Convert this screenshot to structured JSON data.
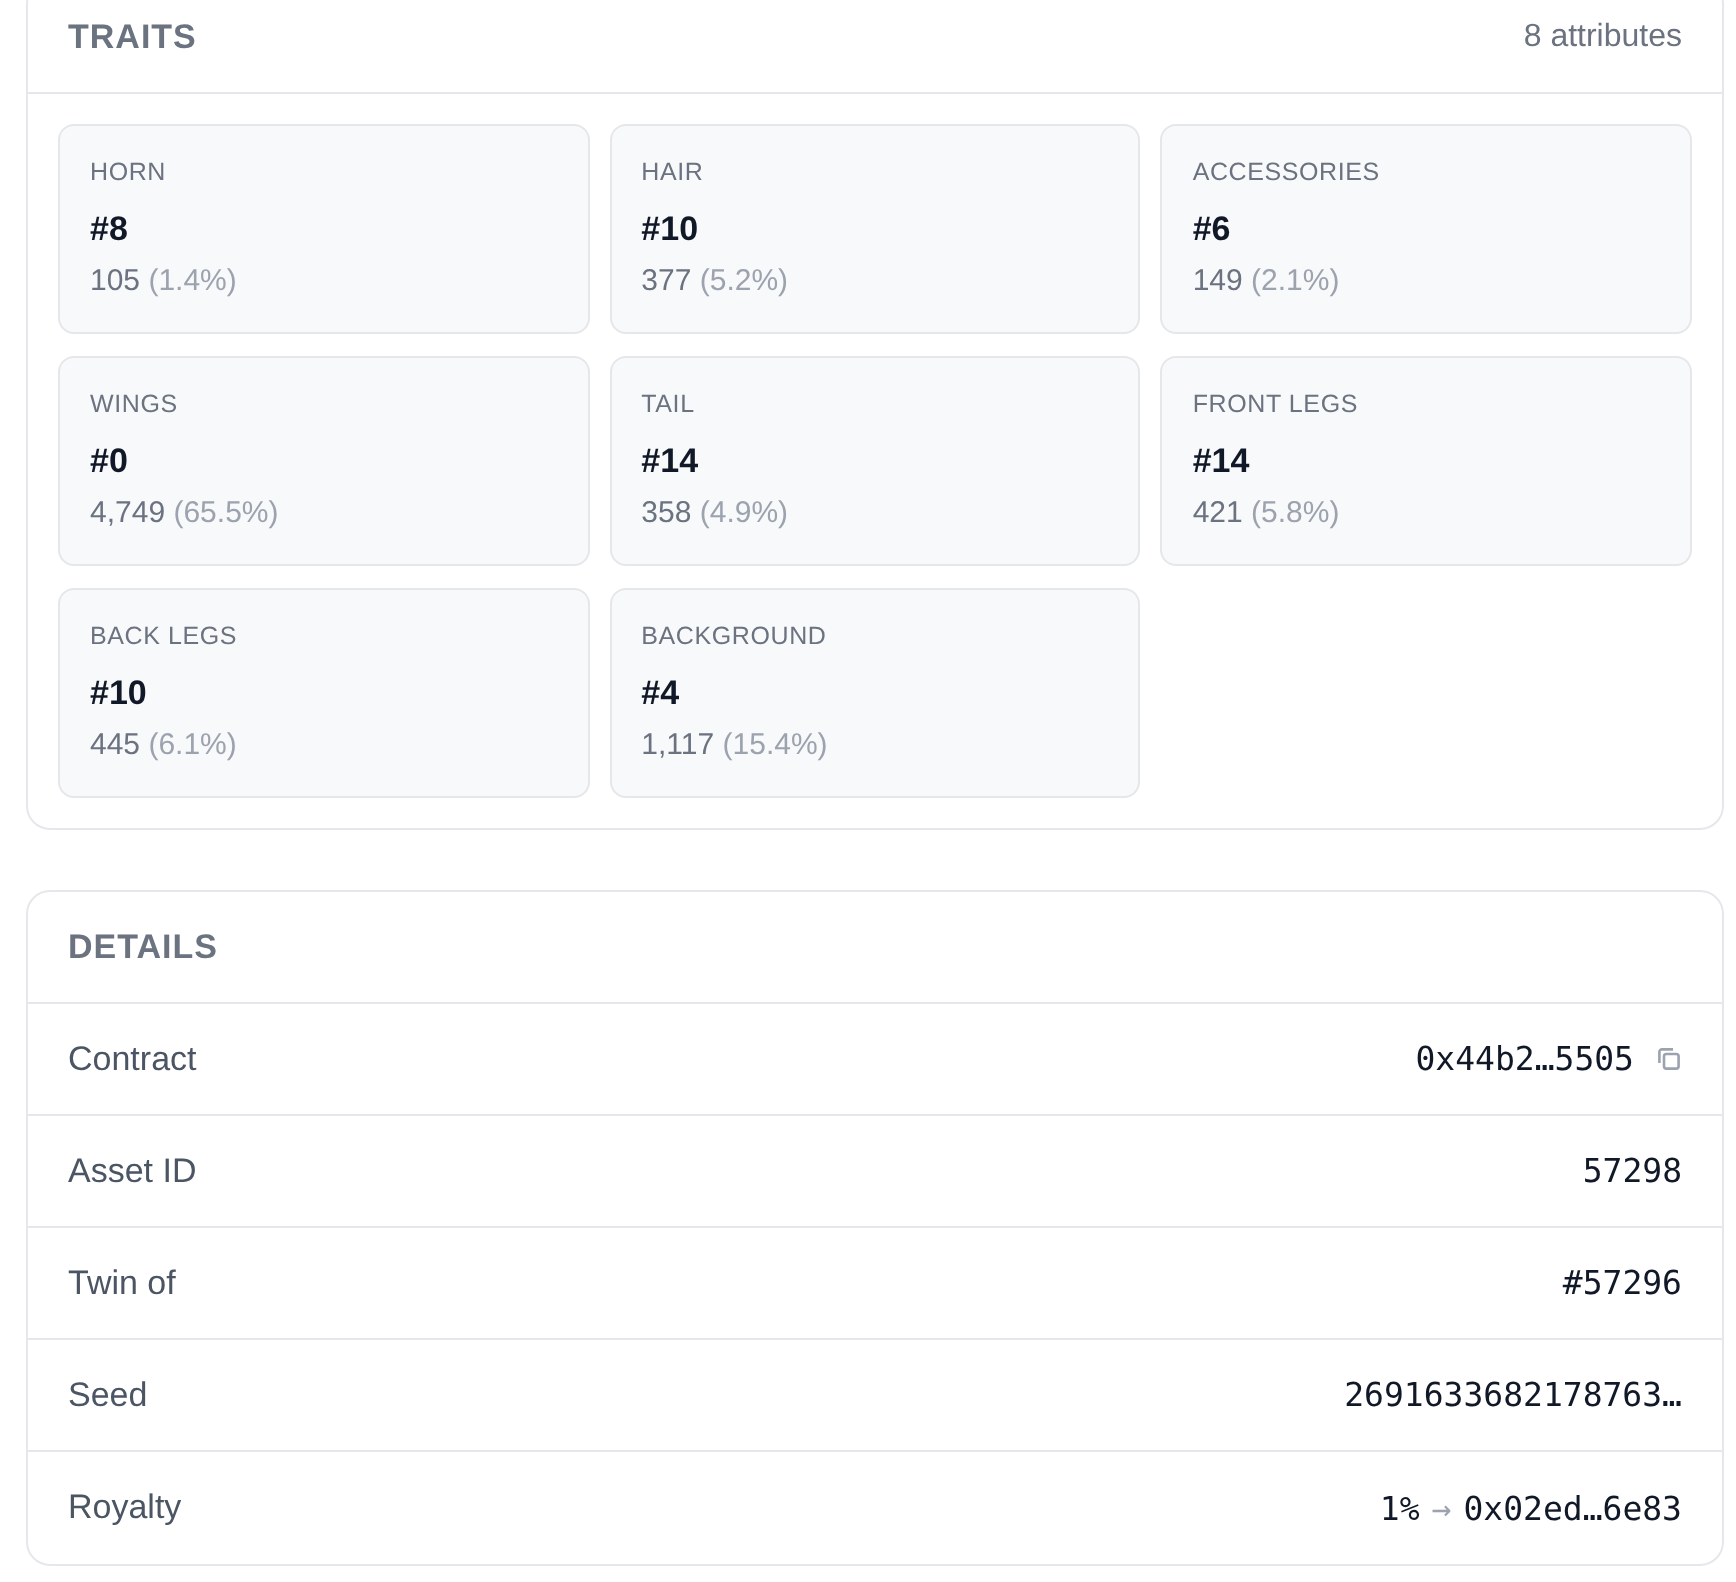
{
  "traits": {
    "title": "TRAITS",
    "summary": "8 attributes",
    "items": [
      {
        "name": "HORN",
        "value": "#8",
        "count": "105",
        "share": "(1.4%)"
      },
      {
        "name": "HAIR",
        "value": "#10",
        "count": "377",
        "share": "(5.2%)"
      },
      {
        "name": "ACCESSORIES",
        "value": "#6",
        "count": "149",
        "share": "(2.1%)"
      },
      {
        "name": "WINGS",
        "value": "#0",
        "count": "4,749",
        "share": "(65.5%)"
      },
      {
        "name": "TAIL",
        "value": "#14",
        "count": "358",
        "share": "(4.9%)"
      },
      {
        "name": "FRONT LEGS",
        "value": "#14",
        "count": "421",
        "share": "(5.8%)"
      },
      {
        "name": "BACK LEGS",
        "value": "#10",
        "count": "445",
        "share": "(6.1%)"
      },
      {
        "name": "BACKGROUND",
        "value": "#4",
        "count": "1,117",
        "share": "(15.4%)"
      }
    ]
  },
  "details": {
    "title": "DETAILS",
    "rows": [
      {
        "kind": "copy",
        "label": "Contract",
        "value": "0x44b2…5505"
      },
      {
        "kind": "plain",
        "label": "Asset ID",
        "value": "57298"
      },
      {
        "kind": "plain",
        "label": "Twin of",
        "value": "#57296"
      },
      {
        "kind": "plain",
        "label": "Seed",
        "value": "2691633682178763…"
      },
      {
        "kind": "transfer",
        "label": "Royalty",
        "value": "1%",
        "arrow": "→",
        "target": "0x02ed…6e83"
      }
    ]
  }
}
